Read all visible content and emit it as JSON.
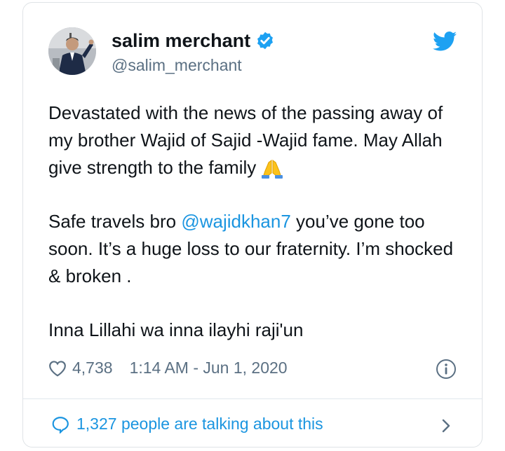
{
  "tweet": {
    "author": {
      "name": "salim merchant",
      "handle": "@salim_merchant",
      "verified": true
    },
    "paragraph1": "Devastated with the news of the passing away of my brother Wajid of Sajid -Wajid fame. May Allah give strength to the family",
    "paragraph1_emoji": "folded-hands-emoji",
    "paragraph2": {
      "before": "Safe travels bro ",
      "mention": "@wajidkhan7",
      "after": " you’ve gone too soon. It’s a huge loss to our fraternity. I’m shocked & broken ."
    },
    "paragraph3": "Inna Lillahi wa inna ilayhi raji'un",
    "likes": "4,738",
    "timestamp": "1:14 AM - Jun 1, 2020",
    "footer": "1,327 people are talking about this"
  },
  "icons": [
    "verified-badge-icon",
    "twitter-bird-icon",
    "heart-icon",
    "info-icon",
    "speech-bubble-icon",
    "chevron-right-icon"
  ],
  "colors": {
    "twitter_blue": "#1da1f2",
    "link_blue": "#1b95e0",
    "secondary_text": "#5b7083",
    "border": "#dfe3e6"
  }
}
